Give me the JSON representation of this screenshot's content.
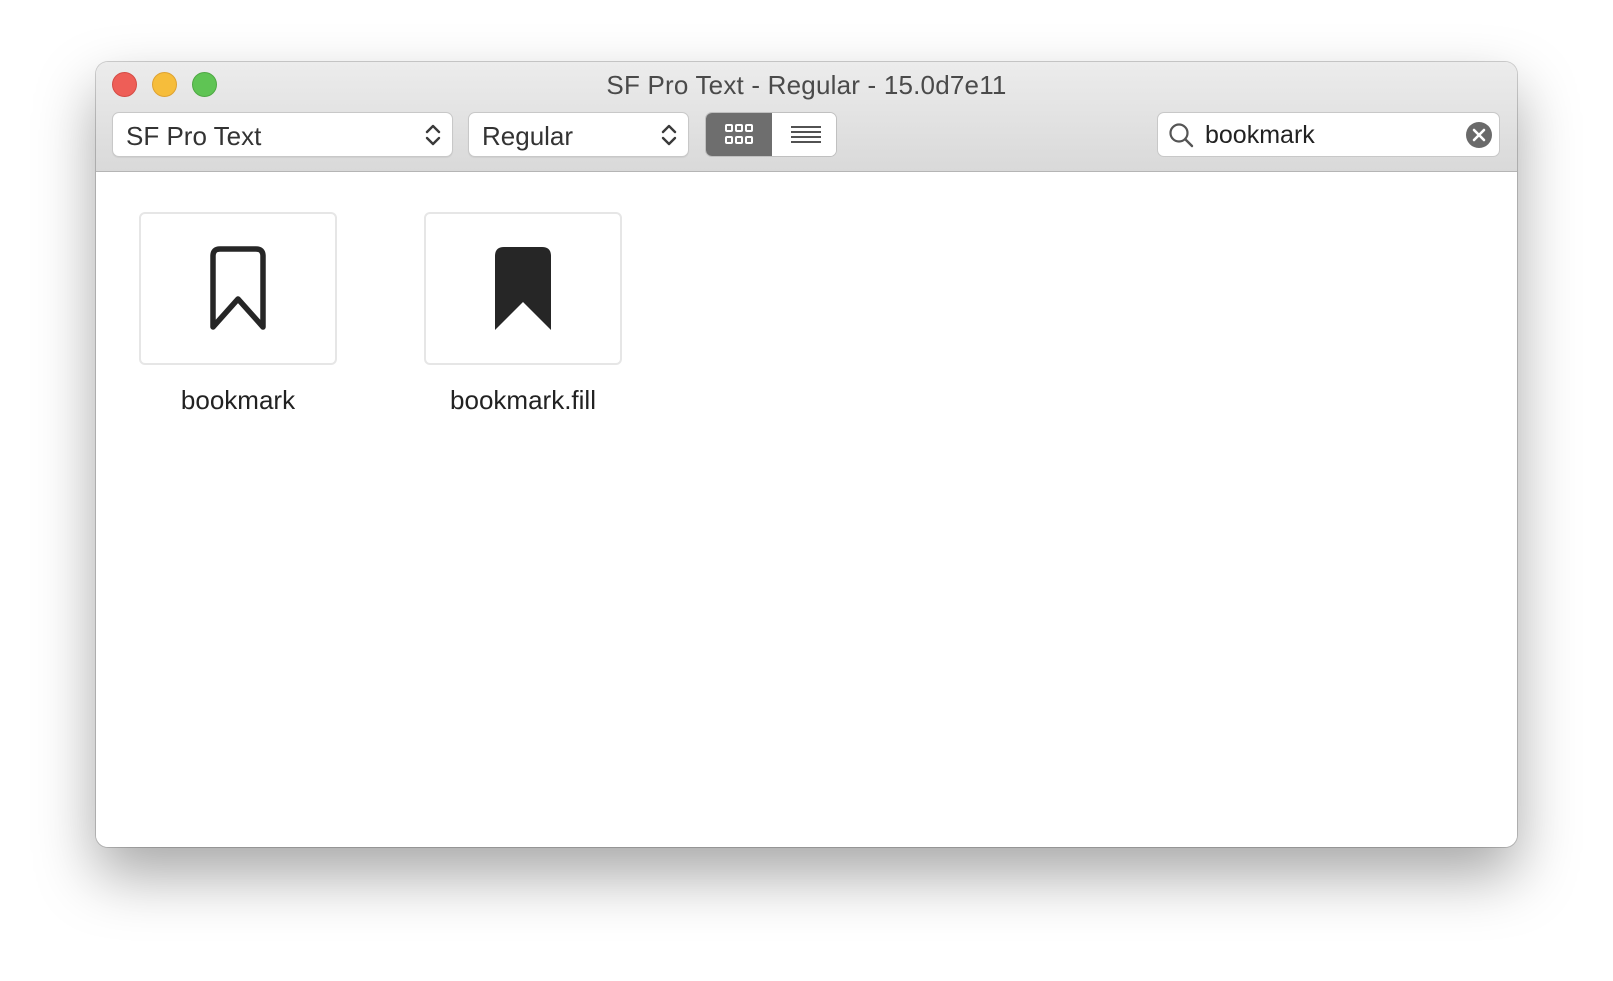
{
  "window": {
    "title": "SF Pro Text - Regular - 15.0d7e11"
  },
  "toolbar": {
    "font_popup": {
      "value": "SF Pro Text",
      "icon": "chevron-up-down-icon"
    },
    "style_popup": {
      "value": "Regular",
      "icon": "chevron-up-down-icon"
    },
    "view_mode": {
      "options": [
        {
          "name": "grid",
          "icon": "grid-icon",
          "selected": true
        },
        {
          "name": "list",
          "icon": "list-icon",
          "selected": false
        }
      ]
    },
    "search": {
      "value": "bookmark",
      "icon": "search-icon",
      "clear_icon": "clear-icon"
    }
  },
  "symbols": [
    {
      "name": "bookmark",
      "icon": "bookmark-icon"
    },
    {
      "name": "bookmark.fill",
      "icon": "bookmark-fill-icon"
    }
  ],
  "colors": {
    "close": "#ee5e57",
    "minimize": "#f6bd3b",
    "maximize": "#5fc454",
    "selected_segment": "#6e6e6e",
    "glyph": "#262626"
  }
}
